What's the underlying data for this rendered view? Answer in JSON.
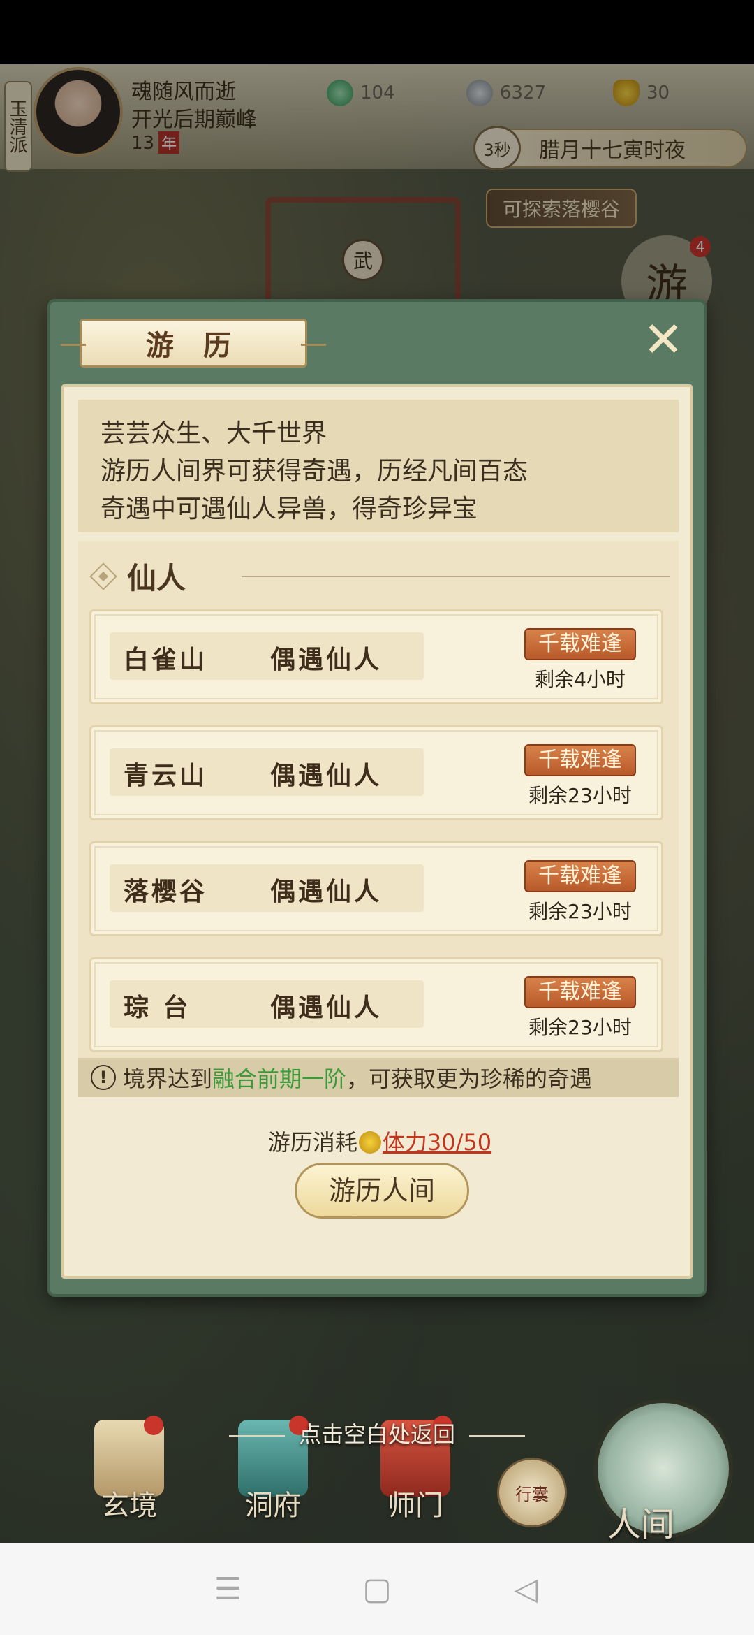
{
  "player": {
    "sect": "玉清派",
    "name": "魂随风而逝",
    "realm": "开光后期巅峰",
    "age_value": "13",
    "age_unit": "年"
  },
  "resources": [
    {
      "icon": "spirit-jade-icon",
      "value": "104"
    },
    {
      "icon": "coin-icon",
      "value": "6327"
    },
    {
      "icon": "gold-ingot-icon",
      "value": "30"
    }
  ],
  "clock": {
    "countdown": "3秒",
    "time_text": "腊月十七寅时夜"
  },
  "map": {
    "explore_tag": "可探索落樱谷",
    "gate_plate": "武",
    "trip_badge": "游",
    "trip_count": "4"
  },
  "modal": {
    "title": "游 历",
    "close_icon": "✕",
    "description": [
      "芸芸众生、大千世界",
      "游历人间界可获得奇遇，历经凡间百态",
      "奇遇中可遇仙人异兽，得奇珍异宝"
    ],
    "section_title": "仙人",
    "encounters": [
      {
        "place": "白雀山",
        "type": "偶遇仙人",
        "rarity": "千载难逢",
        "remaining": "剩余4小时"
      },
      {
        "place": "青云山",
        "type": "偶遇仙人",
        "rarity": "千载难逢",
        "remaining": "剩余23小时"
      },
      {
        "place": "落樱谷",
        "type": "偶遇仙人",
        "rarity": "千载难逢",
        "remaining": "剩余23小时"
      },
      {
        "place": "琮 台",
        "type": "偶遇仙人",
        "rarity": "千载难逢",
        "remaining": "剩余23小时"
      }
    ],
    "realm_tip": {
      "icon": "!",
      "prefix": "境界达到",
      "realm": "融合前期一阶",
      "suffix": "，可获取更为珍稀的奇遇"
    },
    "cost": {
      "label": "游历消耗",
      "value": "体力30/50"
    },
    "go_button": "游历人间"
  },
  "back_hint": "点击空白处返回",
  "bottom_nav": [
    {
      "label": "玄境"
    },
    {
      "label": "洞府"
    },
    {
      "label": "师门"
    },
    {
      "label": "行囊"
    },
    {
      "label": "人间"
    }
  ],
  "colors": {
    "modal_frame": "#5a7a63",
    "parchment": "#f2ead2",
    "rarity_badge": "#c9642f",
    "tip_realm": "#3c9a3a",
    "cost_value": "#c2361f"
  }
}
